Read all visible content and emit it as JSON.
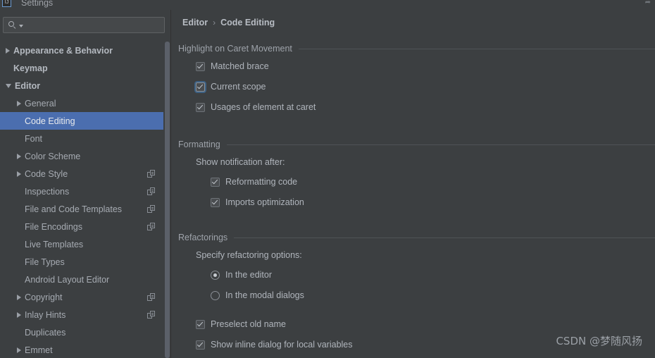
{
  "window": {
    "title": "Settings",
    "icon": "window-icon"
  },
  "sidebar": {
    "search": {
      "value": "",
      "placeholder": "",
      "icon": "search-icon"
    },
    "tree": [
      {
        "label": "Appearance & Behavior",
        "level": 0,
        "arrow": "collapsed",
        "selected": false,
        "copy": false
      },
      {
        "label": "Keymap",
        "level": 0,
        "arrow": "none",
        "selected": false,
        "copy": false
      },
      {
        "label": "Editor",
        "level": 0,
        "arrow": "expanded",
        "selected": false,
        "copy": false
      },
      {
        "label": "General",
        "level": 1,
        "arrow": "collapsed",
        "selected": false,
        "copy": false
      },
      {
        "label": "Code Editing",
        "level": 1,
        "arrow": "none",
        "selected": true,
        "copy": false
      },
      {
        "label": "Font",
        "level": 1,
        "arrow": "none",
        "selected": false,
        "copy": false
      },
      {
        "label": "Color Scheme",
        "level": 1,
        "arrow": "collapsed",
        "selected": false,
        "copy": false
      },
      {
        "label": "Code Style",
        "level": 1,
        "arrow": "collapsed",
        "selected": false,
        "copy": true
      },
      {
        "label": "Inspections",
        "level": 1,
        "arrow": "none",
        "selected": false,
        "copy": true
      },
      {
        "label": "File and Code Templates",
        "level": 1,
        "arrow": "none",
        "selected": false,
        "copy": true
      },
      {
        "label": "File Encodings",
        "level": 1,
        "arrow": "none",
        "selected": false,
        "copy": true
      },
      {
        "label": "Live Templates",
        "level": 1,
        "arrow": "none",
        "selected": false,
        "copy": false
      },
      {
        "label": "File Types",
        "level": 1,
        "arrow": "none",
        "selected": false,
        "copy": false
      },
      {
        "label": "Android Layout Editor",
        "level": 1,
        "arrow": "none",
        "selected": false,
        "copy": false
      },
      {
        "label": "Copyright",
        "level": 1,
        "arrow": "collapsed",
        "selected": false,
        "copy": true
      },
      {
        "label": "Inlay Hints",
        "level": 1,
        "arrow": "collapsed",
        "selected": false,
        "copy": true
      },
      {
        "label": "Duplicates",
        "level": 1,
        "arrow": "none",
        "selected": false,
        "copy": false
      },
      {
        "label": "Emmet",
        "level": 1,
        "arrow": "collapsed",
        "selected": false,
        "copy": false
      }
    ]
  },
  "content": {
    "breadcrumb": {
      "parent": "Editor",
      "separator": "›",
      "current": "Code Editing"
    },
    "sections": [
      {
        "title": "Highlight on Caret Movement",
        "options": [
          {
            "type": "checkbox",
            "label": "Matched brace",
            "checked": true,
            "focused": false
          },
          {
            "type": "checkbox",
            "label": "Current scope",
            "checked": true,
            "focused": true
          },
          {
            "type": "checkbox",
            "label": "Usages of element at caret",
            "checked": true,
            "focused": false
          }
        ]
      },
      {
        "title": "Formatting",
        "subtitle": "Show notification after:",
        "options": [
          {
            "type": "checkbox",
            "label": "Reformatting code",
            "checked": true,
            "focused": false
          },
          {
            "type": "checkbox",
            "label": "Imports optimization",
            "checked": true,
            "focused": false
          }
        ]
      },
      {
        "title": "Refactorings",
        "subtitle": "Specify refactoring options:",
        "options": [
          {
            "type": "radio",
            "label": "In the editor",
            "checked": true,
            "focused": false
          },
          {
            "type": "radio",
            "label": "In the modal dialogs",
            "checked": false,
            "focused": false
          },
          {
            "type": "checkbox",
            "label": "Preselect old name",
            "checked": true,
            "focused": false
          },
          {
            "type": "checkbox",
            "label": "Show inline dialog for local variables",
            "checked": true,
            "focused": false
          }
        ]
      }
    ]
  },
  "watermark": "CSDN @梦随风扬",
  "colors": {
    "background": "#3c3f41",
    "selection": "#4b6eaf",
    "text": "#b0b5bc",
    "muted": "#9ea3aa",
    "focus_ring": "#3d6185"
  }
}
